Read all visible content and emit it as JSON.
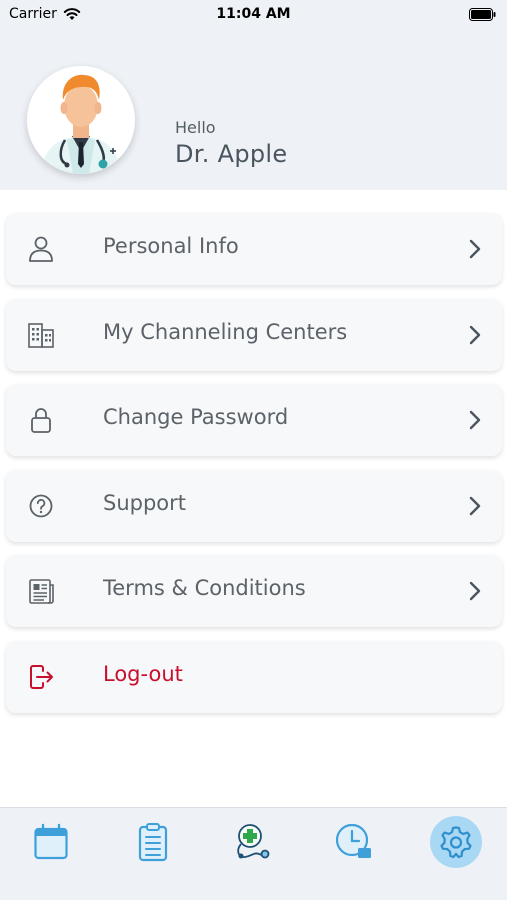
{
  "status_bar": {
    "carrier": "Carrier",
    "time": "11:04 AM"
  },
  "profile": {
    "greeting": "Hello",
    "name": "Dr. Apple"
  },
  "menu": {
    "items": [
      {
        "label": "Personal Info",
        "icon": "person-icon"
      },
      {
        "label": "My Channeling Centers",
        "icon": "building-icon"
      },
      {
        "label": "Change Password",
        "icon": "lock-icon"
      },
      {
        "label": "Support",
        "icon": "question-circle-icon"
      },
      {
        "label": "Terms & Conditions",
        "icon": "document-icon"
      },
      {
        "label": "Log-out",
        "icon": "logout-icon"
      }
    ]
  },
  "tab_bar": {
    "tabs": [
      {
        "icon": "calendar-icon"
      },
      {
        "icon": "clipboard-icon"
      },
      {
        "icon": "stethoscope-icon"
      },
      {
        "icon": "clock-icon"
      },
      {
        "icon": "gear-icon",
        "active": true
      }
    ]
  },
  "colors": {
    "accent": "#3fa0d9",
    "logout": "#c8102e",
    "header_bg": "#eef2f7"
  }
}
